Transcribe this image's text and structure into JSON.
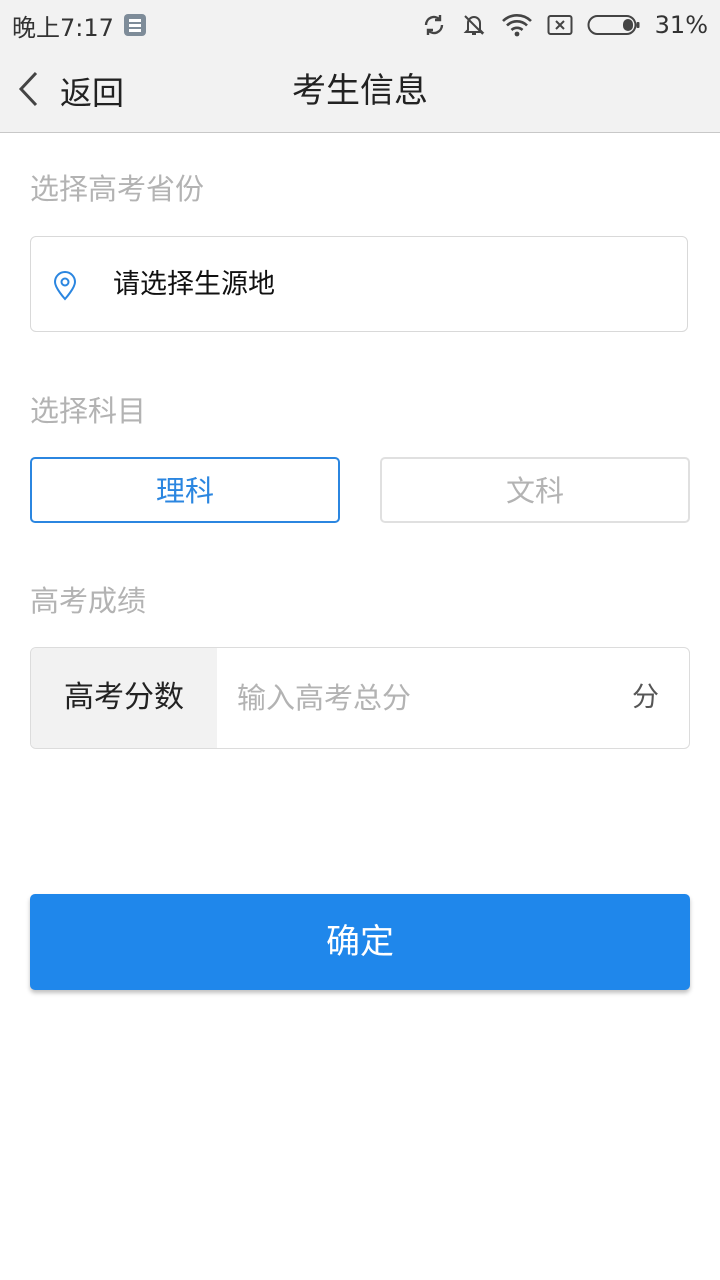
{
  "status_bar": {
    "time": "晚上7:17",
    "battery_percent": "31%",
    "battery_level": 0.31,
    "icons": [
      "sim-icon",
      "sync-icon",
      "mute-bell-icon",
      "wifi-icon",
      "sim-blocked-icon",
      "battery-icon"
    ]
  },
  "nav": {
    "back_label": "返回",
    "back_icon": "chevron-left-icon",
    "title": "考生信息"
  },
  "province": {
    "section_label": "选择高考省份",
    "icon": "location-pin-icon",
    "placeholder": "请选择生源地"
  },
  "subject": {
    "section_label": "选择科目",
    "options": [
      {
        "label": "理科",
        "selected": true
      },
      {
        "label": "文科",
        "selected": false
      }
    ],
    "accent_color": "#2b86e0"
  },
  "score": {
    "section_label": "高考成绩",
    "field_label": "高考分数",
    "placeholder": "输入高考总分",
    "value": "",
    "unit": "分"
  },
  "confirm": {
    "label": "确定",
    "color": "#1f87eb"
  }
}
